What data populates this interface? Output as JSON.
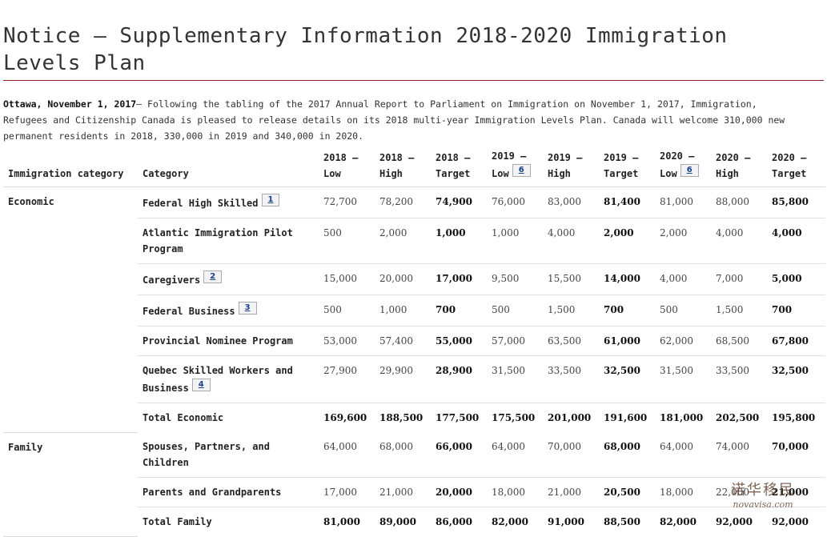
{
  "title": "Notice – Supplementary Information 2018-2020 Immigration Levels Plan",
  "intro": {
    "dateline": "Ottawa, November 1, 2017",
    "dash": "—",
    "text": " Following the tabling of the 2017 Annual Report to Parliament on Immigration on November 1, 2017, Immigration, Refugees and Citizenship Canada is pleased to release details on its 2018 multi-year Immigration Levels Plan. Canada will welcome 310,000 new permanent residents in 2018, 330,000 in 2019 and 340,000 in 2020."
  },
  "table": {
    "headers": {
      "immigration_category": "Immigration category",
      "category": "Category",
      "c2018_low": "2018 – Low",
      "c2018_high": "2018 – High",
      "c2018_target": "2018 – Target",
      "c2019_low": "2019 – Low",
      "c2019_low_fn": "6",
      "c2019_high": "2019 – High",
      "c2019_target": "2019 – Target",
      "c2020_low": "2020 – Low",
      "c2020_low_fn": "6",
      "c2020_high": "2020 – High",
      "c2020_target": "2020 – Target"
    },
    "groups": [
      {
        "name": "Economic",
        "rows": [
          {
            "category": "Federal High Skilled",
            "fn": "1",
            "values": [
              "72,700",
              "78,200",
              "74,900",
              "76,000",
              "83,000",
              "81,400",
              "81,000",
              "88,000",
              "85,800"
            ]
          },
          {
            "category": "Atlantic Immigration Pilot Program",
            "fn": "",
            "values": [
              "500",
              "2,000",
              "1,000",
              "1,000",
              "4,000",
              "2,000",
              "2,000",
              "4,000",
              "4,000"
            ]
          },
          {
            "category": "Caregivers",
            "fn": "2",
            "values": [
              "15,000",
              "20,000",
              "17,000",
              "9,500",
              "15,500",
              "14,000",
              "4,000",
              "7,000",
              "5,000"
            ]
          },
          {
            "category": "Federal Business",
            "fn": "3",
            "values": [
              "500",
              "1,000",
              "700",
              "500",
              "1,500",
              "700",
              "500",
              "1,500",
              "700"
            ]
          },
          {
            "category": "Provincial Nominee Program",
            "fn": "",
            "values": [
              "53,000",
              "57,400",
              "55,000",
              "57,000",
              "63,500",
              "61,000",
              "62,000",
              "68,500",
              "67,800"
            ]
          },
          {
            "category": "Quebec Skilled Workers and Business",
            "fn": "4",
            "values": [
              "27,900",
              "29,900",
              "28,900",
              "31,500",
              "33,500",
              "32,500",
              "31,500",
              "33,500",
              "32,500"
            ]
          }
        ],
        "total": {
          "category": "Total Economic",
          "values": [
            "169,600",
            "188,500",
            "177,500",
            "175,500",
            "201,000",
            "191,600",
            "181,000",
            "202,500",
            "195,800"
          ]
        }
      },
      {
        "name": "Family",
        "rows": [
          {
            "category": "Spouses, Partners, and Children",
            "fn": "",
            "values": [
              "64,000",
              "68,000",
              "66,000",
              "64,000",
              "70,000",
              "68,000",
              "64,000",
              "74,000",
              "70,000"
            ]
          },
          {
            "category": "Parents and Grandparents",
            "fn": "",
            "values": [
              "17,000",
              "21,000",
              "20,000",
              "18,000",
              "21,000",
              "20,500",
              "18,000",
              "22,000",
              "21,000"
            ]
          }
        ],
        "total": {
          "category": "Total Family",
          "values": [
            "81,000",
            "89,000",
            "86,000",
            "82,000",
            "91,000",
            "88,500",
            "82,000",
            "92,000",
            "92,000"
          ]
        }
      }
    ]
  },
  "watermark": {
    "cn": "诺华移民",
    "en": "novavisa.com"
  },
  "colors": {
    "rule": "#8a1f23",
    "footnote_link": "#1a3f8a"
  }
}
